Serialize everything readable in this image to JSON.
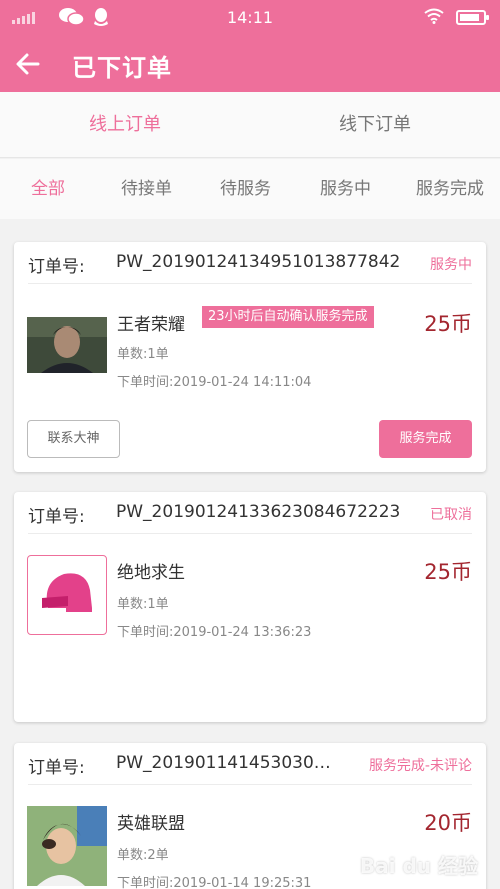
{
  "status_bar": {
    "time": "14:11",
    "icons": [
      "signal-icon",
      "wechat-icon",
      "qq-icon",
      "wifi-icon",
      "battery-icon"
    ],
    "battery_level": 0.85
  },
  "nav": {
    "back_icon": "arrow-left-icon",
    "title": "已下订单"
  },
  "tabs_primary": [
    {
      "label": "线上订单",
      "active": true
    },
    {
      "label": "线下订单",
      "active": false
    }
  ],
  "tabs_secondary": [
    {
      "label": "全部",
      "active": true
    },
    {
      "label": "待接单",
      "active": false
    },
    {
      "label": "待服务",
      "active": false
    },
    {
      "label": "服务中",
      "active": false
    },
    {
      "label": "服务完成",
      "active": false
    }
  ],
  "colors": {
    "accent": "#ee6f9b",
    "price": "#a3262f",
    "text": "#333333",
    "muted": "#888888"
  },
  "orders": [
    {
      "label": "订单号:",
      "number": "PW_20190124134951013877842",
      "status": "服务中",
      "game": "王者荣耀",
      "badge": "23小时后自动确认服务完成",
      "price": "25币",
      "qty": "单数:1单",
      "time": "下单时间:2019-01-24 14:11:04",
      "contact_button": "联系大神",
      "complete_button": "服务完成"
    },
    {
      "label": "订单号:",
      "number": "PW_20190124133623084672223",
      "status": "已取消",
      "game": "绝地求生",
      "icon": "helmet-icon",
      "price": "25币",
      "qty": "单数:1单",
      "time": "下单时间:2019-01-24 13:36:23"
    },
    {
      "label": "订单号:",
      "number": "PW_201901141453030…",
      "status": "服务完成-未评论",
      "game": "英雄联盟",
      "price": "20币",
      "qty": "单数:2单",
      "time": "下单时间:2019-01-14 19:25:31"
    }
  ],
  "watermark": "Bai du 经验"
}
